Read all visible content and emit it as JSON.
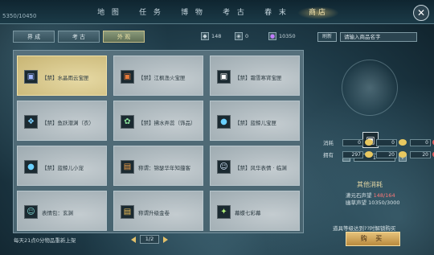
{
  "topbar": {
    "exp": "5350/10450",
    "nav": [
      "地 图",
      "任 务",
      "博 物",
      "考 古",
      "春 末",
      "商店"
    ],
    "active_nav": 5
  },
  "tabs": [
    "界 成",
    "考 古",
    "外 观"
  ],
  "active_tab": 2,
  "currencies": [
    {
      "icon": "coin-icon",
      "value": "148"
    },
    {
      "icon": "gem-icon",
      "value": "0"
    },
    {
      "icon": "orb-icon",
      "value": "10350"
    }
  ],
  "search": {
    "refresh_label": "刷新",
    "placeholder": "请输入商品名字"
  },
  "items": [
    "【禁】水晶雨云宝匣",
    "【禁】江枫渔火宝匣",
    "【禁】霜雪寒宵宝匣",
    "【禁】鱼跃潜渊（衣）",
    "【禁】拂水弄蕊（饰品）",
    "【禁】蓝鲸儿宝匣",
    "【禁】蓝鲸儿小宠",
    "称谓：锦瑟华年知蕴客",
    "【禁】风华表情 · 临渊",
    "表情包：玄渊",
    "称谓升级金卷",
    "幕蝶七彩幕"
  ],
  "footer": {
    "refresh_note": "每天21点0分物品重新上架",
    "page": "1/2"
  },
  "panel": {
    "qty": "1",
    "consume_label": "消耗",
    "own_label": "拥有",
    "consume": [
      "0",
      "0",
      "0"
    ],
    "own": [
      "297",
      "20",
      "20"
    ],
    "other_title": "其他消耗",
    "other_lines": [
      {
        "label": "潇元石声望",
        "value": "148/164"
      },
      {
        "label": "幽草声望",
        "value": "10350/3000"
      }
    ],
    "reason": "道具等级达到??时解锁购买",
    "buy": "购 买"
  }
}
